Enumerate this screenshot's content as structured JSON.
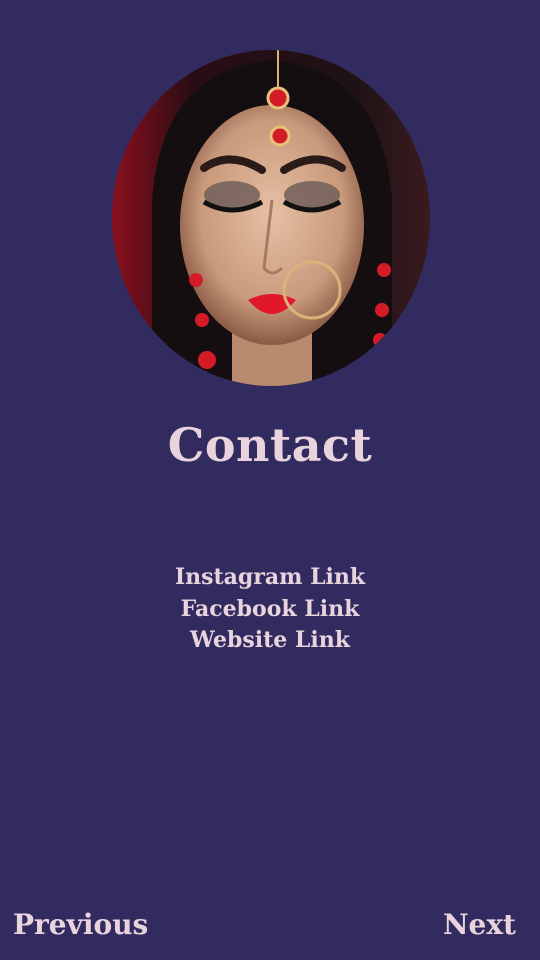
{
  "page": {
    "title": "Contact",
    "background_color": "#312b60",
    "text_color": "#e9d3dc"
  },
  "profile_image": {
    "icon": "portrait-photo"
  },
  "links": [
    {
      "label": "Instagram Link"
    },
    {
      "label": "Facebook Link"
    },
    {
      "label": "Website Link"
    }
  ],
  "navigation": {
    "previous_label": "Previous",
    "next_label": "Next"
  }
}
